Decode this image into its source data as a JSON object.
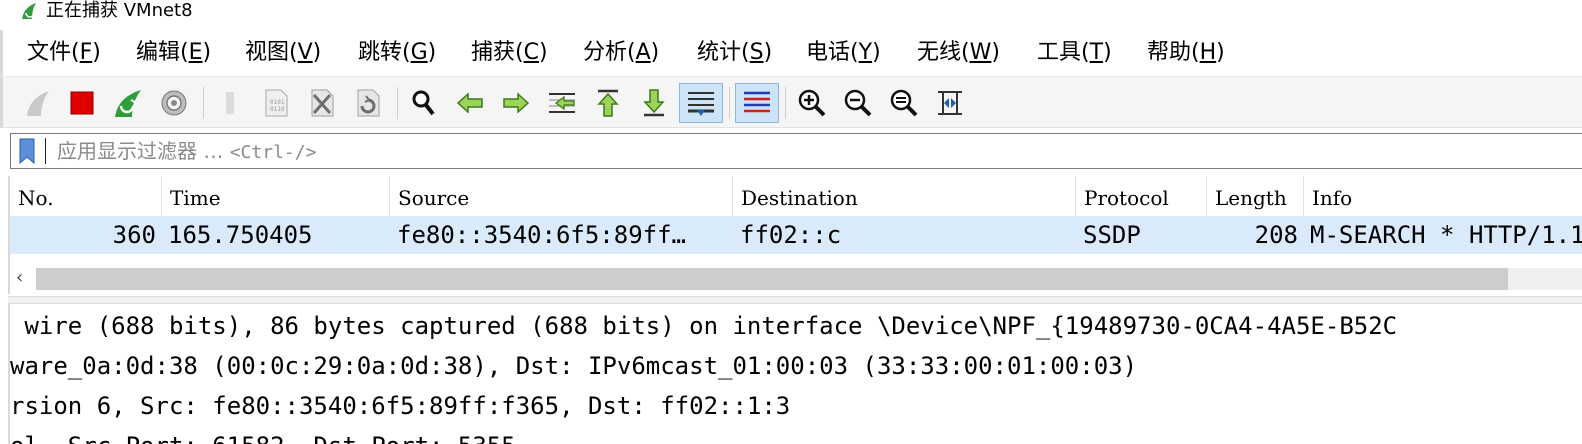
{
  "window": {
    "title": "正在捕获 VMnet8"
  },
  "menu": [
    {
      "label": "文件",
      "key": "F"
    },
    {
      "label": "编辑",
      "key": "E"
    },
    {
      "label": "视图",
      "key": "V"
    },
    {
      "label": "跳转",
      "key": "G"
    },
    {
      "label": "捕获",
      "key": "C"
    },
    {
      "label": "分析",
      "key": "A"
    },
    {
      "label": "统计",
      "key": "S"
    },
    {
      "label": "电话",
      "key": "Y"
    },
    {
      "label": "无线",
      "key": "W"
    },
    {
      "label": "工具",
      "key": "T"
    },
    {
      "label": "帮助",
      "key": "H"
    }
  ],
  "toolbar_icons": [
    "start-capture-icon",
    "stop-capture-icon",
    "restart-capture-icon",
    "capture-options-icon",
    "open-file-icon",
    "save-file-icon",
    "close-file-icon",
    "reload-file-icon",
    "find-packet-icon",
    "go-back-icon",
    "go-forward-icon",
    "go-to-packet-icon",
    "first-packet-icon",
    "last-packet-icon",
    "autoscroll-icon",
    "colorize-icon",
    "zoom-in-icon",
    "zoom-out-icon",
    "zoom-normal-icon",
    "resize-columns-icon"
  ],
  "filter": {
    "placeholder_cn": "应用显示过滤器 … ",
    "placeholder_shortcut": "<Ctrl-/>"
  },
  "packet_list": {
    "columns": [
      "No.",
      "Time",
      "Source",
      "Destination",
      "Protocol",
      "Length",
      "Info"
    ],
    "rows": [
      {
        "no": "360",
        "time": "165.750405",
        "source": "fe80::3540:6f5:89ff…",
        "destination": "ff02::c",
        "protocol": "SSDP",
        "length": "208",
        "info": "M-SEARCH * HTTP/1.1"
      }
    ]
  },
  "details": [
    " wire (688 bits), 86 bytes captured (688 bits) on interface \\Device\\NPF_{19489730-0CA4-4A5E-B52C",
    "ware_0a:0d:38 (00:0c:29:0a:0d:38), Dst: IPv6mcast_01:00:03 (33:33:00:01:00:03)",
    "rsion 6, Src: fe80::3540:6f5:89ff:f365, Dst: ff02::1:3",
    "ol, Src Port: 61582, Dst Port: 5355"
  ],
  "colors": {
    "selected_row": "#d9eafa",
    "stop_red": "#e00000",
    "shark_green": "#2e9e3a",
    "active_button": "#cde4f7"
  }
}
